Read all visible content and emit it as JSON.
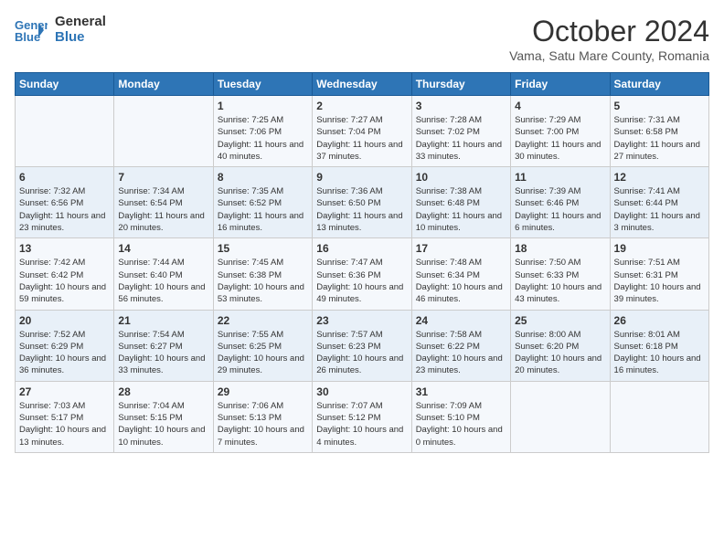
{
  "header": {
    "logo_line1": "General",
    "logo_line2": "Blue",
    "month": "October 2024",
    "location": "Vama, Satu Mare County, Romania"
  },
  "weekdays": [
    "Sunday",
    "Monday",
    "Tuesday",
    "Wednesday",
    "Thursday",
    "Friday",
    "Saturday"
  ],
  "weeks": [
    [
      {
        "day": null,
        "detail": null
      },
      {
        "day": null,
        "detail": null
      },
      {
        "day": "1",
        "detail": "Sunrise: 7:25 AM\nSunset: 7:06 PM\nDaylight: 11 hours and 40 minutes."
      },
      {
        "day": "2",
        "detail": "Sunrise: 7:27 AM\nSunset: 7:04 PM\nDaylight: 11 hours and 37 minutes."
      },
      {
        "day": "3",
        "detail": "Sunrise: 7:28 AM\nSunset: 7:02 PM\nDaylight: 11 hours and 33 minutes."
      },
      {
        "day": "4",
        "detail": "Sunrise: 7:29 AM\nSunset: 7:00 PM\nDaylight: 11 hours and 30 minutes."
      },
      {
        "day": "5",
        "detail": "Sunrise: 7:31 AM\nSunset: 6:58 PM\nDaylight: 11 hours and 27 minutes."
      }
    ],
    [
      {
        "day": "6",
        "detail": "Sunrise: 7:32 AM\nSunset: 6:56 PM\nDaylight: 11 hours and 23 minutes."
      },
      {
        "day": "7",
        "detail": "Sunrise: 7:34 AM\nSunset: 6:54 PM\nDaylight: 11 hours and 20 minutes."
      },
      {
        "day": "8",
        "detail": "Sunrise: 7:35 AM\nSunset: 6:52 PM\nDaylight: 11 hours and 16 minutes."
      },
      {
        "day": "9",
        "detail": "Sunrise: 7:36 AM\nSunset: 6:50 PM\nDaylight: 11 hours and 13 minutes."
      },
      {
        "day": "10",
        "detail": "Sunrise: 7:38 AM\nSunset: 6:48 PM\nDaylight: 11 hours and 10 minutes."
      },
      {
        "day": "11",
        "detail": "Sunrise: 7:39 AM\nSunset: 6:46 PM\nDaylight: 11 hours and 6 minutes."
      },
      {
        "day": "12",
        "detail": "Sunrise: 7:41 AM\nSunset: 6:44 PM\nDaylight: 11 hours and 3 minutes."
      }
    ],
    [
      {
        "day": "13",
        "detail": "Sunrise: 7:42 AM\nSunset: 6:42 PM\nDaylight: 10 hours and 59 minutes."
      },
      {
        "day": "14",
        "detail": "Sunrise: 7:44 AM\nSunset: 6:40 PM\nDaylight: 10 hours and 56 minutes."
      },
      {
        "day": "15",
        "detail": "Sunrise: 7:45 AM\nSunset: 6:38 PM\nDaylight: 10 hours and 53 minutes."
      },
      {
        "day": "16",
        "detail": "Sunrise: 7:47 AM\nSunset: 6:36 PM\nDaylight: 10 hours and 49 minutes."
      },
      {
        "day": "17",
        "detail": "Sunrise: 7:48 AM\nSunset: 6:34 PM\nDaylight: 10 hours and 46 minutes."
      },
      {
        "day": "18",
        "detail": "Sunrise: 7:50 AM\nSunset: 6:33 PM\nDaylight: 10 hours and 43 minutes."
      },
      {
        "day": "19",
        "detail": "Sunrise: 7:51 AM\nSunset: 6:31 PM\nDaylight: 10 hours and 39 minutes."
      }
    ],
    [
      {
        "day": "20",
        "detail": "Sunrise: 7:52 AM\nSunset: 6:29 PM\nDaylight: 10 hours and 36 minutes."
      },
      {
        "day": "21",
        "detail": "Sunrise: 7:54 AM\nSunset: 6:27 PM\nDaylight: 10 hours and 33 minutes."
      },
      {
        "day": "22",
        "detail": "Sunrise: 7:55 AM\nSunset: 6:25 PM\nDaylight: 10 hours and 29 minutes."
      },
      {
        "day": "23",
        "detail": "Sunrise: 7:57 AM\nSunset: 6:23 PM\nDaylight: 10 hours and 26 minutes."
      },
      {
        "day": "24",
        "detail": "Sunrise: 7:58 AM\nSunset: 6:22 PM\nDaylight: 10 hours and 23 minutes."
      },
      {
        "day": "25",
        "detail": "Sunrise: 8:00 AM\nSunset: 6:20 PM\nDaylight: 10 hours and 20 minutes."
      },
      {
        "day": "26",
        "detail": "Sunrise: 8:01 AM\nSunset: 6:18 PM\nDaylight: 10 hours and 16 minutes."
      }
    ],
    [
      {
        "day": "27",
        "detail": "Sunrise: 7:03 AM\nSunset: 5:17 PM\nDaylight: 10 hours and 13 minutes."
      },
      {
        "day": "28",
        "detail": "Sunrise: 7:04 AM\nSunset: 5:15 PM\nDaylight: 10 hours and 10 minutes."
      },
      {
        "day": "29",
        "detail": "Sunrise: 7:06 AM\nSunset: 5:13 PM\nDaylight: 10 hours and 7 minutes."
      },
      {
        "day": "30",
        "detail": "Sunrise: 7:07 AM\nSunset: 5:12 PM\nDaylight: 10 hours and 4 minutes."
      },
      {
        "day": "31",
        "detail": "Sunrise: 7:09 AM\nSunset: 5:10 PM\nDaylight: 10 hours and 0 minutes."
      },
      {
        "day": null,
        "detail": null
      },
      {
        "day": null,
        "detail": null
      }
    ]
  ]
}
